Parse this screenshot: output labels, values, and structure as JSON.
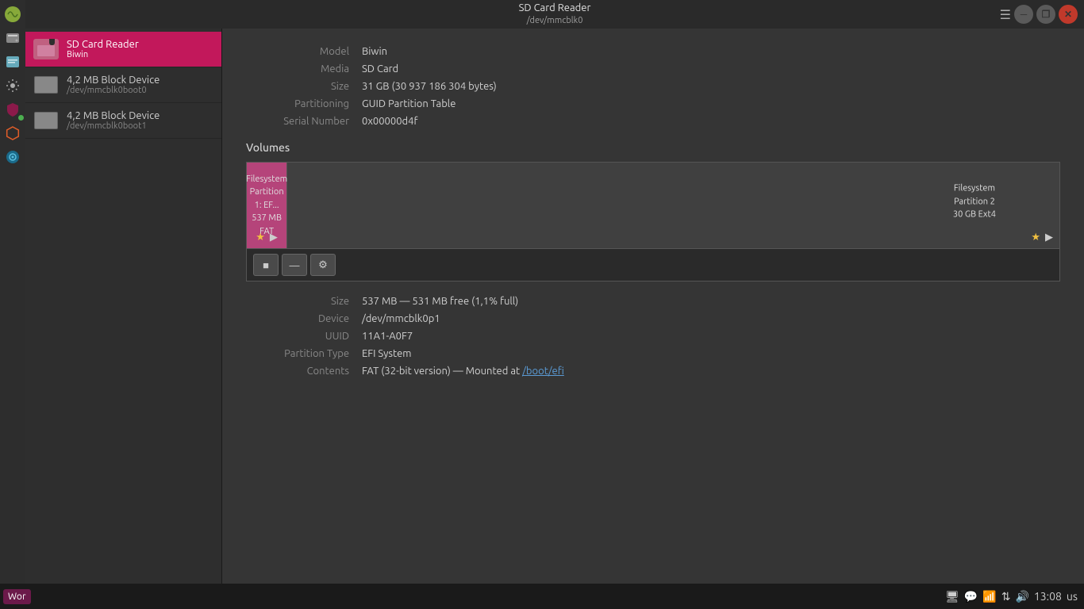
{
  "window": {
    "title": "SD Card Reader",
    "device_path": "/dev/mmcblk0",
    "menu_icon": "☰",
    "minimize_label": "─",
    "restore_label": "❐",
    "close_label": "✕"
  },
  "sidebar": {
    "items": [
      {
        "id": "sd-card-reader",
        "label": "SD Card Reader",
        "sublabel": "Biwin",
        "active": true,
        "icon": "sd"
      },
      {
        "id": "block1",
        "label": "4,2 MB Block Device",
        "sublabel": "/dev/mmcblk0boot0",
        "active": false,
        "icon": "hdd"
      },
      {
        "id": "block2",
        "label": "4,2 MB Block Device",
        "sublabel": "/dev/mmcblk0boot1",
        "active": false,
        "icon": "hdd"
      }
    ]
  },
  "device_info": {
    "model_label": "Model",
    "model_value": "Biwin",
    "media_label": "Media",
    "media_value": "SD Card",
    "size_label": "Size",
    "size_value": "31 GB (30 937 186 304 bytes)",
    "partitioning_label": "Partitioning",
    "partitioning_value": "GUID Partition Table",
    "serial_number_label": "Serial Number",
    "serial_number_value": "0x00000d4f"
  },
  "volumes": {
    "title": "Volumes",
    "partition1": {
      "label": "Filesystem\nPartition 1: EF...\n537 MB FAT",
      "line1": "Filesystem",
      "line2": "Partition 1: EF...",
      "line3": "537 MB FAT",
      "width_pct": 5
    },
    "partition2": {
      "label": "Filesystem\nPartition 2\n30 GB Ext4",
      "line1": "Filesystem",
      "line2": "Partition 2",
      "line3": "30 GB Ext4",
      "width_pct": 95
    },
    "toolbar": {
      "add_label": "■",
      "remove_label": "—",
      "settings_label": "⚙"
    }
  },
  "partition_details": {
    "size_label": "Size",
    "size_value": "537 MB — 531 MB free (1,1% full)",
    "device_label": "Device",
    "device_value": "/dev/mmcblk0p1",
    "uuid_label": "UUID",
    "uuid_value": "11A1-A0F7",
    "partition_type_label": "Partition Type",
    "partition_type_value": "EFI System",
    "contents_label": "Contents",
    "contents_value_prefix": "FAT (32-bit version) — Mounted at ",
    "contents_link": "/boot/efi"
  },
  "taskbar": {
    "bottom": {
      "wor_label": "Wor",
      "time": "13:08",
      "locale": "us",
      "green_dot_label": "●"
    }
  },
  "left_icons": [
    {
      "id": "logo",
      "symbol": "🌿"
    },
    {
      "id": "disks",
      "symbol": "💾"
    },
    {
      "id": "files",
      "symbol": "📁"
    },
    {
      "id": "system-settings",
      "symbol": "⚙"
    },
    {
      "id": "mintupdate",
      "symbol": "🛡"
    },
    {
      "id": "git",
      "symbol": "⬡"
    },
    {
      "id": "profile",
      "symbol": "👤"
    }
  ]
}
